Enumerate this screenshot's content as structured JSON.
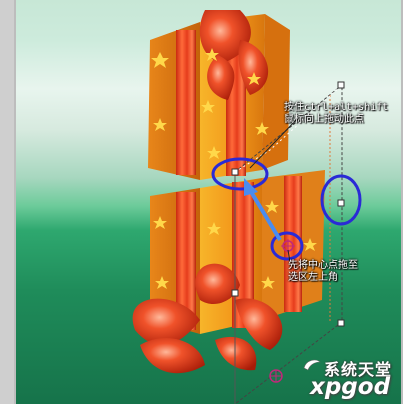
{
  "annotations": {
    "top_line1": "按住ctrl+alt+shift",
    "top_line2": "鼠标向上拖动此点",
    "bottom_line1": "先将中心点拖至",
    "bottom_line2": "选区左上角"
  },
  "watermark": {
    "top_text": "系统天堂",
    "bottom_text": "xpgod"
  },
  "colors": {
    "highlight_circle": "#2a2ad6",
    "arrow": "#4a8cf0",
    "gift_orange": "#f39a1c",
    "ribbon_red": "#e43a1a",
    "background_green": "#1f8c5a"
  },
  "icons": {
    "transform_handle": "square-handle-icon",
    "center_point": "crosshair-icon",
    "direction": "arrow-icon"
  }
}
